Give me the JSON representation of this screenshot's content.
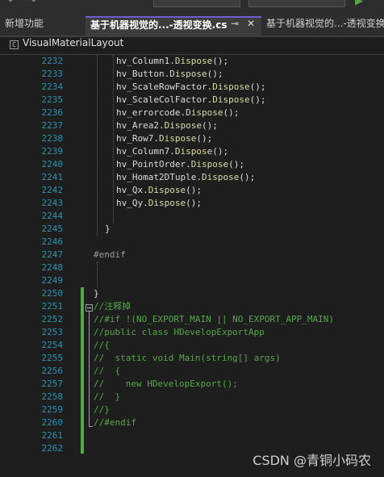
{
  "tabs": [
    {
      "label": "新增功能",
      "active": false
    },
    {
      "label": "基于机器视觉的...-透视变换.cs",
      "active": true
    },
    {
      "label": "基于机器视觉的...-透视变换",
      "active": false
    }
  ],
  "nav": {
    "class_label": "VisualMaterialLayout"
  },
  "editor": {
    "lines": [
      {
        "num": "2232",
        "code": "hv_Column1.Dispose();",
        "kind": "dispose"
      },
      {
        "num": "2233",
        "code": "hv_Button.Dispose();",
        "kind": "dispose"
      },
      {
        "num": "2234",
        "code": "hv_ScaleRowFactor.Dispose();",
        "kind": "dispose"
      },
      {
        "num": "2235",
        "code": "hv_ScaleColFactor.Dispose();",
        "kind": "dispose"
      },
      {
        "num": "2236",
        "code": "hv_errorcode.Dispose();",
        "kind": "dispose"
      },
      {
        "num": "2237",
        "code": "hv_Area2.Dispose();",
        "kind": "dispose"
      },
      {
        "num": "2238",
        "code": "hv_Row7.Dispose();",
        "kind": "dispose"
      },
      {
        "num": "2239",
        "code": "hv_Column7.Dispose();",
        "kind": "dispose"
      },
      {
        "num": "2240",
        "code": "hv_PointOrder.Dispose();",
        "kind": "dispose"
      },
      {
        "num": "2241",
        "code": "hv_Homat2DTuple.Dispose();",
        "kind": "dispose"
      },
      {
        "num": "2242",
        "code": "hv_Qx.Dispose();",
        "kind": "dispose"
      },
      {
        "num": "2243",
        "code": "hv_Qy.Dispose();",
        "kind": "dispose"
      },
      {
        "num": "2244",
        "code": "",
        "kind": "blank"
      },
      {
        "num": "2245",
        "code": "}",
        "kind": "brace-inner"
      },
      {
        "num": "2246",
        "code": "",
        "kind": "blank"
      },
      {
        "num": "2247",
        "code": "#endif",
        "kind": "preproc"
      },
      {
        "num": "2248",
        "code": "",
        "kind": "blank"
      },
      {
        "num": "2249",
        "code": "",
        "kind": "blank"
      },
      {
        "num": "2250",
        "code": "}",
        "kind": "brace-outer"
      },
      {
        "num": "2251",
        "code": "//注释掉",
        "kind": "comment"
      },
      {
        "num": "2252",
        "code": "//#if !(NO_EXPORT_MAIN || NO_EXPORT_APP_MAIN)",
        "kind": "comment"
      },
      {
        "num": "2253",
        "code": "//public class HDevelopExportApp",
        "kind": "comment"
      },
      {
        "num": "2254",
        "code": "//{",
        "kind": "comment"
      },
      {
        "num": "2255",
        "code": "//  static void Main(string[] args)",
        "kind": "comment"
      },
      {
        "num": "2256",
        "code": "//  {",
        "kind": "comment"
      },
      {
        "num": "2257",
        "code": "//    new HDevelopExport();",
        "kind": "comment"
      },
      {
        "num": "2258",
        "code": "//  }",
        "kind": "comment"
      },
      {
        "num": "2259",
        "code": "//}",
        "kind": "comment"
      },
      {
        "num": "2260",
        "code": "//#endif",
        "kind": "comment"
      },
      {
        "num": "2261",
        "code": "",
        "kind": "blank"
      },
      {
        "num": "2262",
        "code": "",
        "kind": "blank"
      }
    ]
  },
  "watermark": "CSDN @青铜小码农",
  "colors": {
    "line_number": "#2b91af",
    "comment": "#57a64a",
    "identifier": "#dcdcdc",
    "method": "#dcdcaa",
    "preprocessor": "#9b9b9b",
    "change_bar": "#57a64a",
    "active_tab_accent": "#6b5fd3"
  },
  "icons": {
    "pin": "pin-icon",
    "close": "close-icon",
    "class": "class-icon",
    "fold": "collapse-icon"
  }
}
